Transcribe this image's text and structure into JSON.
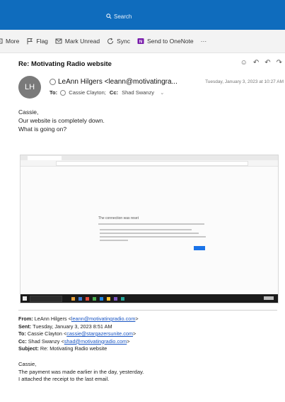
{
  "search": {
    "label": "Search"
  },
  "toolbar": {
    "more": "More",
    "flag": "Flag",
    "mark_unread": "Mark Unread",
    "sync": "Sync",
    "send_to_onenote": "Send to OneNote",
    "overflow": "···"
  },
  "message": {
    "subject": "Re: Motivating Radio website",
    "avatar_initials": "LH",
    "sender": "LeAnn Hilgers <leann@motivatingra...",
    "date": "Tuesday, January 3, 2023 at 10:27 AM",
    "to_label": "To:",
    "to_value": "Cassie Clayton;",
    "cc_label": "Cc:",
    "cc_value": "Shad Swanzy",
    "body_lines": [
      "Cassie,",
      "Our website is completely down.",
      "What is going on?"
    ]
  },
  "embedded_screenshot": {
    "error_title": "The connection was reset"
  },
  "forwarded": {
    "from_label": "From:",
    "from_name": "LeAnn Hilgers <",
    "from_email": "leann@motivatingradio.com",
    "from_end": ">",
    "sent_label": "Sent:",
    "sent_value": "Tuesday, January 3, 2023 8:51 AM",
    "to_label": "To:",
    "to_name": "Cassie Clayton <",
    "to_email": "cassie@stargazersunite.com",
    "to_end": ">",
    "cc_label": "Cc:",
    "cc_name": "Shad Swanzy <",
    "cc_email": "shad@motivatingradio.com",
    "cc_end": ">",
    "subject_label": "Subject:",
    "subject_value": "Re: Motivating Radio website"
  },
  "reply_body": [
    "Cassie,",
    "The payment was made earlier in the day, yesterday.",
    "I attached the receipt to the last email."
  ],
  "colors": {
    "accent": "#0f6cbd",
    "onenote": "#7719aa",
    "link": "#1a56c4"
  }
}
